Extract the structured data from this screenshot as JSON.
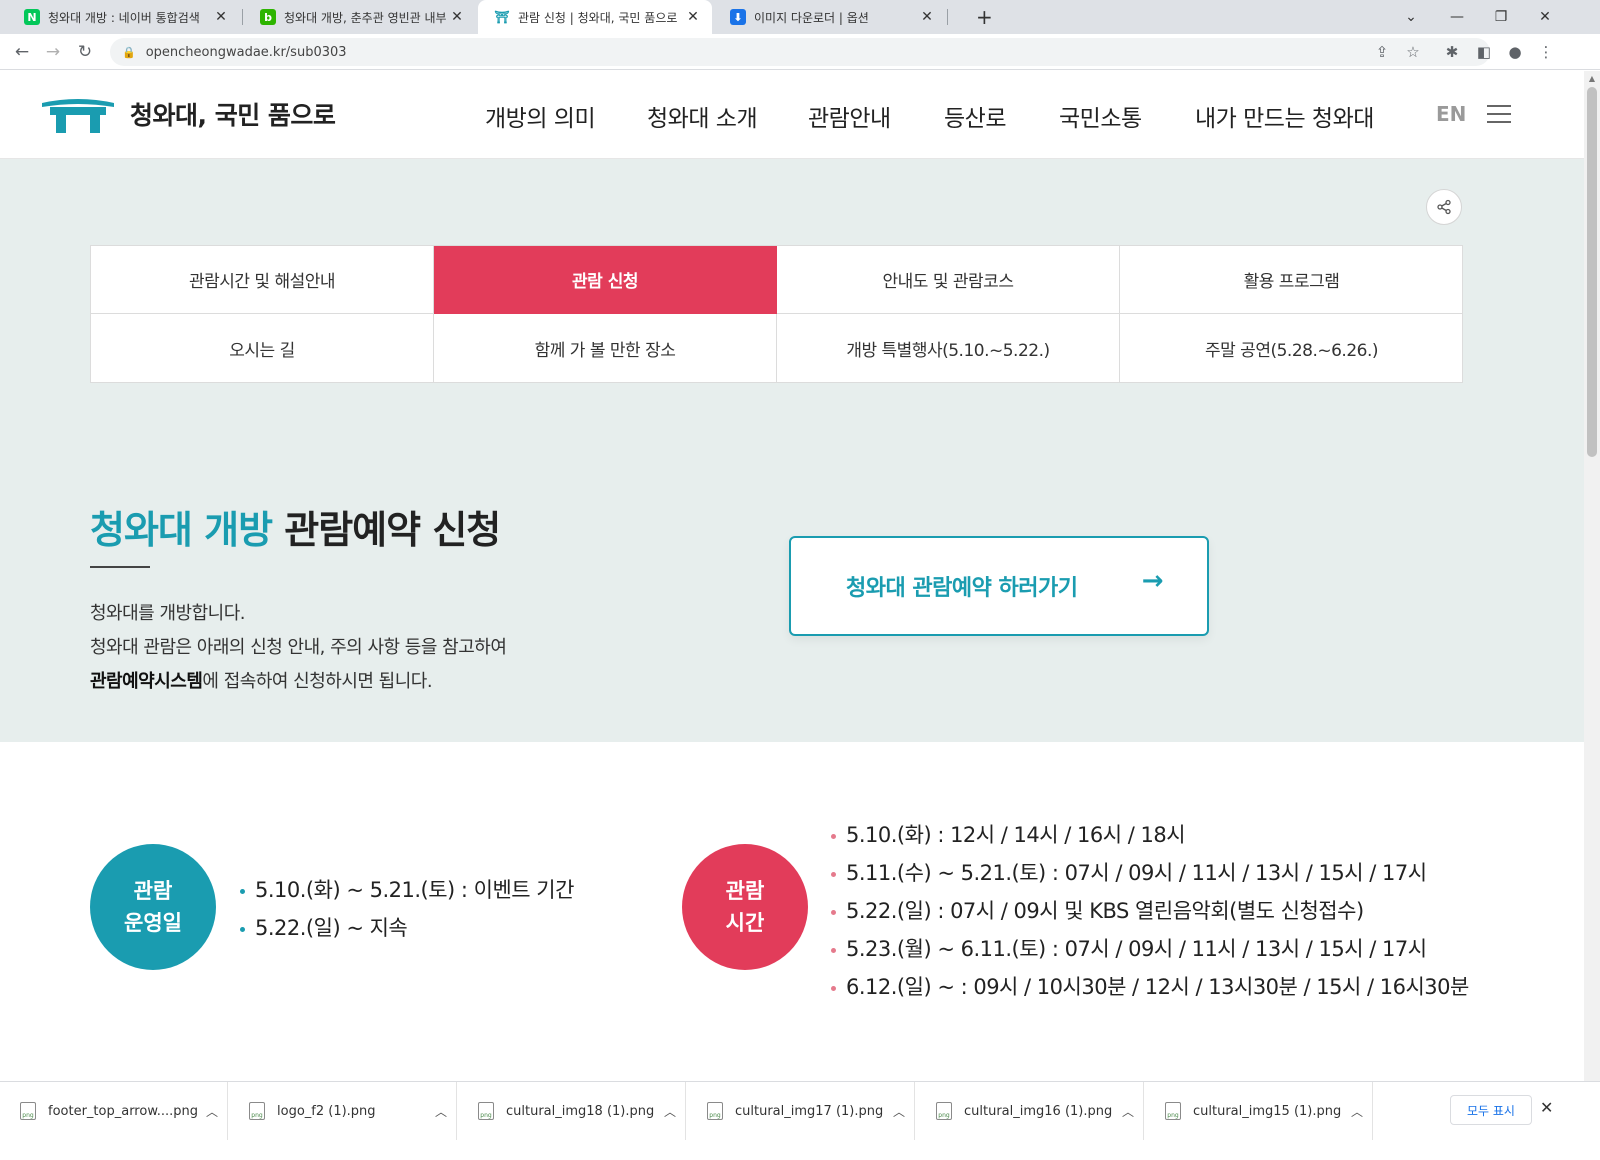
{
  "browser": {
    "tabs": [
      {
        "title": "청와대 개방 : 네이버 통합검색",
        "favicon": "naver-icon",
        "favicon_color": "#03c75a",
        "favicon_glyph": "N"
      },
      {
        "title": "청와대 개방, 춘추관 영빈관 내부",
        "favicon": "blog-icon",
        "favicon_color": "#2db400",
        "favicon_glyph": "b"
      },
      {
        "title": "관람 신청 | 청와대, 국민 품으로",
        "favicon": "cheongwadae-icon",
        "favicon_color": "#1a9cb0",
        "favicon_glyph": "⛩"
      },
      {
        "title": "이미지 다운로더 | 옵션",
        "favicon": "download-icon",
        "favicon_color": "#1a73e8",
        "favicon_glyph": "⬇"
      }
    ],
    "url": "opencheongwadae.kr/sub0303"
  },
  "header": {
    "logo_text": "청와대, 국민 품으로",
    "nav": [
      "개방의 의미",
      "청와대 소개",
      "관람안내",
      "등산로",
      "국민소통",
      "내가 만드는 청와대"
    ],
    "lang": "EN"
  },
  "subnav": [
    "관람시간 및 해설안내",
    "관람 신청",
    "안내도 및 관람코스",
    "활용 프로그램",
    "오시는 길",
    "함께 가 볼 만한 장소",
    "개방 특별행사(5.10.~5.22.)",
    "주말 공연(5.28.~6.26.)"
  ],
  "hero": {
    "title_highlight": "청와대 개방",
    "title_rest": " 관람예약 신청",
    "desc_line1": "청와대를 개방합니다.",
    "desc_line2": "청와대 관람은 아래의 신청 안내, 주의 사항 등을 참고하여",
    "desc_bold": "관람예약시스템",
    "desc_line3_rest": "에 접속하여 신청하시면 됩니다.",
    "cta_label": "청와대 관람예약 하러가기",
    "cta_arrow": "→"
  },
  "operation": {
    "circle_line1": "관람",
    "circle_line2": "운영일",
    "items": [
      "5.10.(화) ~ 5.21.(토) : 이벤트 기간",
      "5.22.(일) ~ 지속"
    ]
  },
  "hours": {
    "circle_line1": "관람",
    "circle_line2": "시간",
    "items": [
      "5.10.(화) : 12시 / 14시 / 16시 / 18시",
      "5.11.(수) ~ 5.21.(토) : 07시 / 09시 / 11시 / 13시 / 15시 / 17시",
      "5.22.(일) : 07시 / 09시 및 KBS 열린음악회(별도 신청접수)",
      "5.23.(월) ~ 6.11.(토) : 07시 / 09시 / 11시 / 13시 / 15시 / 17시",
      "6.12.(일) ~ : 09시 / 10시30분 / 12시 / 13시30분 / 15시 / 16시30분"
    ]
  },
  "downloads": {
    "files": [
      "footer_top_arrow....png",
      "logo_f2 (1).png",
      "cultural_img18 (1).png",
      "cultural_img17 (1).png",
      "cultural_img16 (1).png",
      "cultural_img15 (1).png"
    ],
    "show_all": "모두 표시"
  }
}
